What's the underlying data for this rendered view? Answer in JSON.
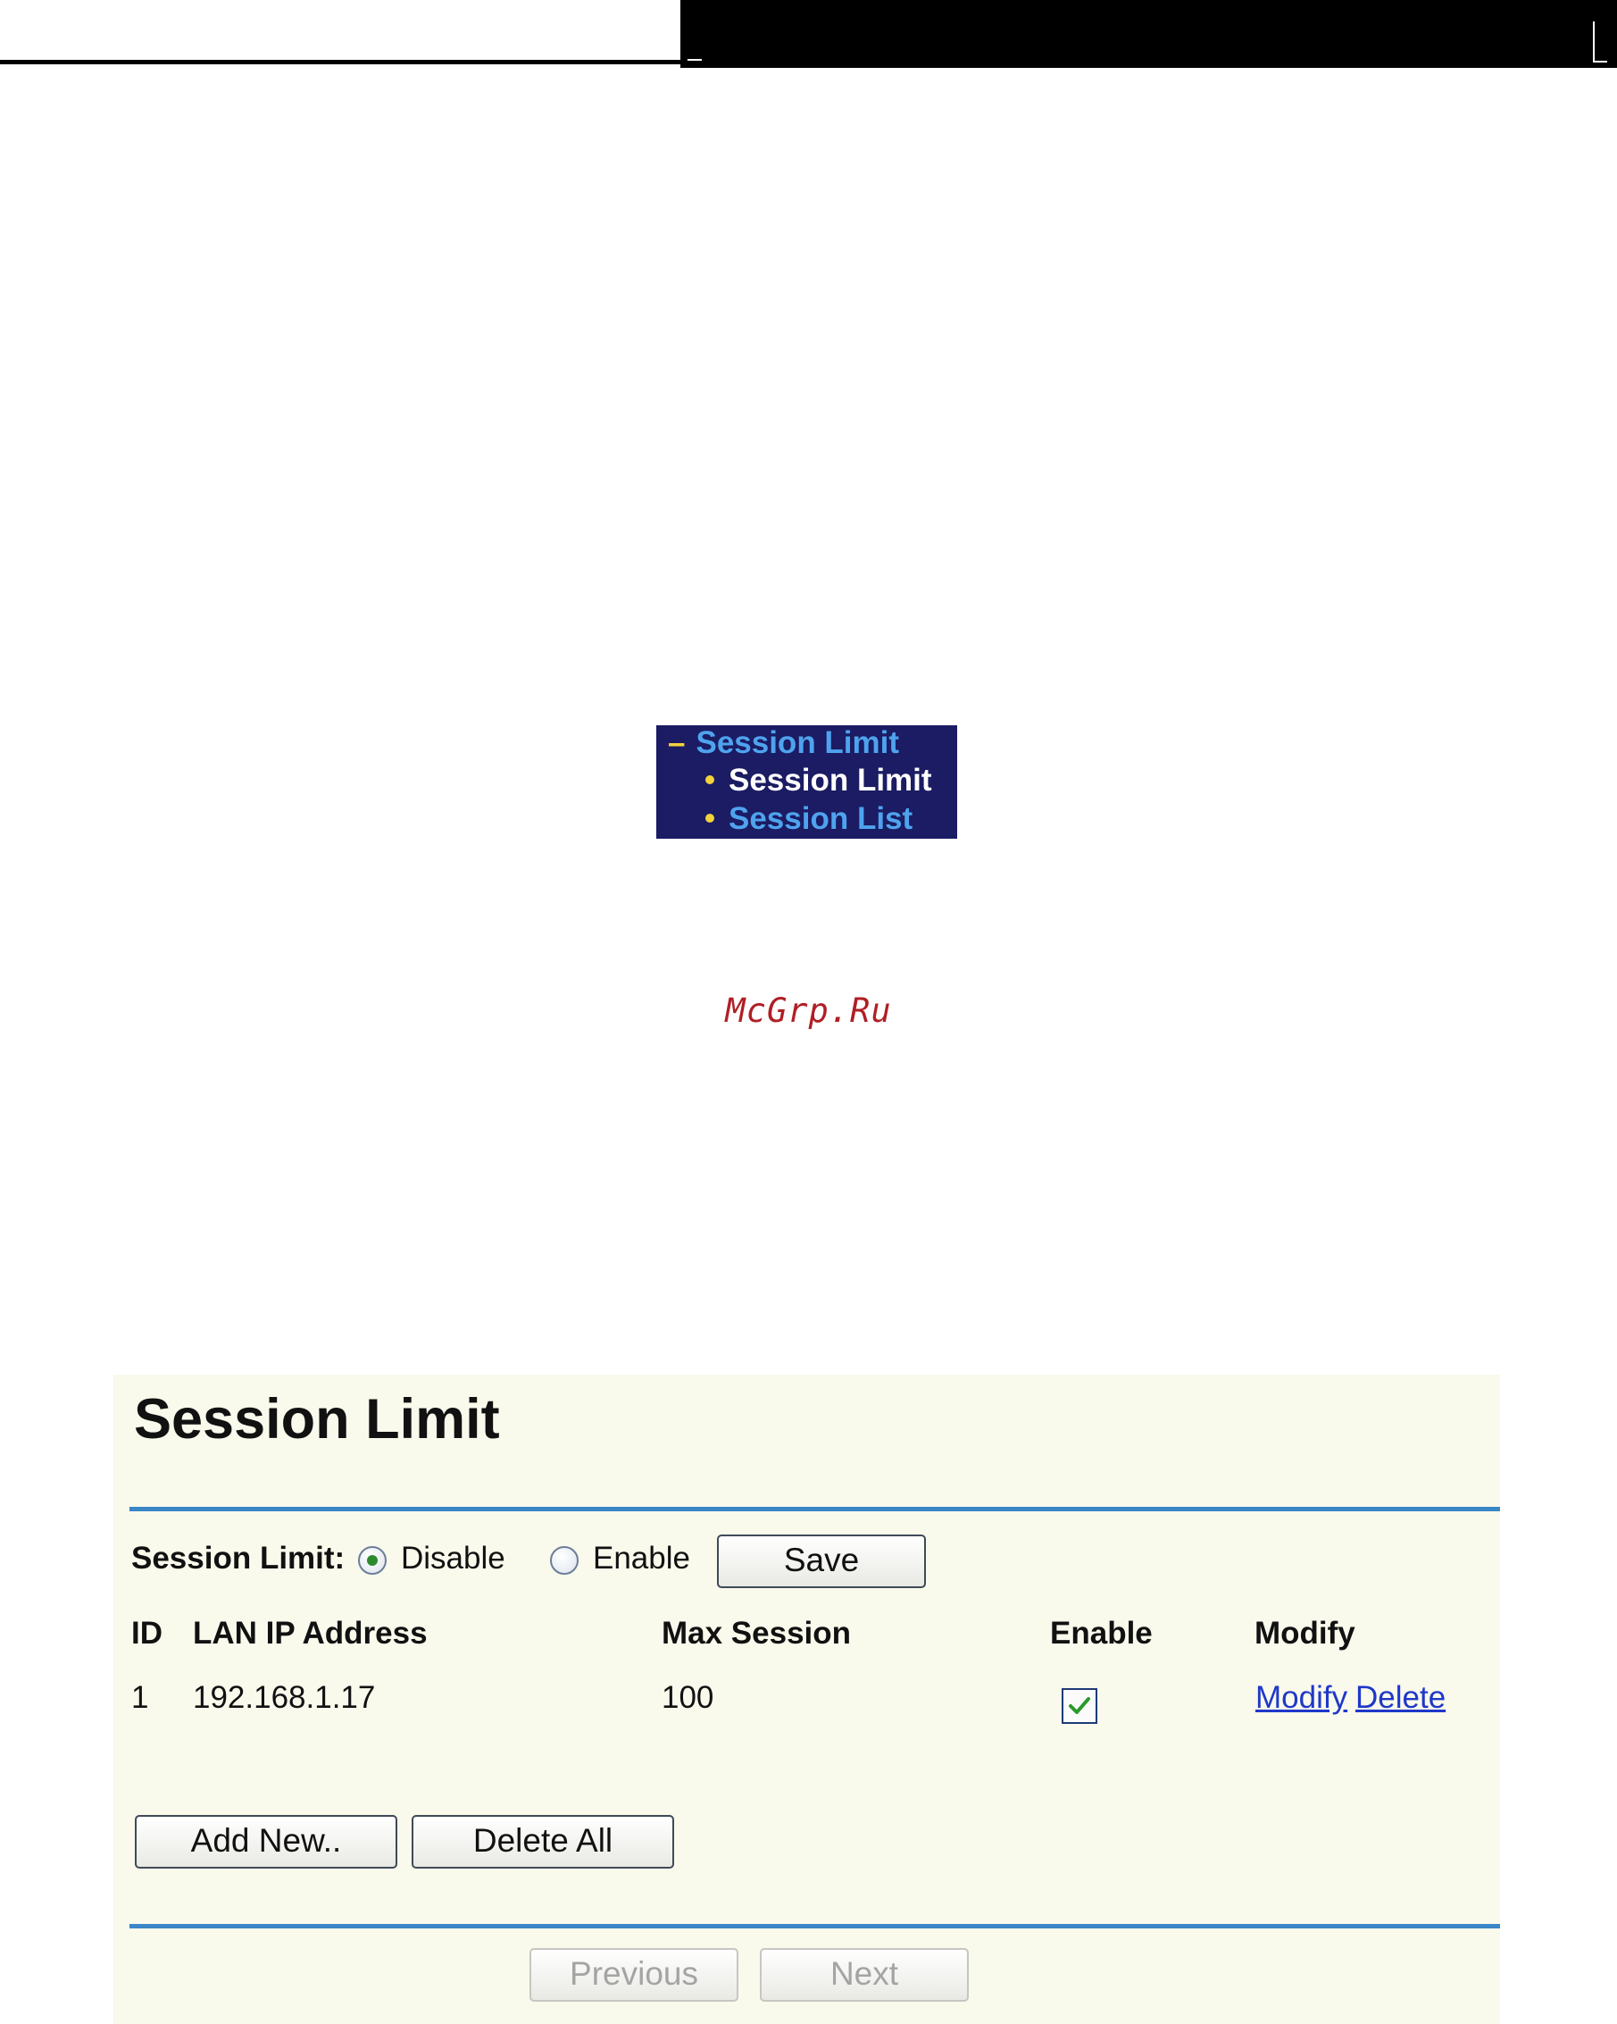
{
  "menu": {
    "section": "Session Limit",
    "items": [
      {
        "label": "Session Limit"
      },
      {
        "label": "Session List"
      }
    ]
  },
  "watermark": "McGrp.Ru",
  "panel": {
    "title": "Session Limit",
    "session_limit_label": "Session Limit:",
    "options": {
      "disable": "Disable",
      "enable": "Enable",
      "selected": "Disable"
    },
    "save_label": "Save",
    "table": {
      "headers": [
        "ID",
        "LAN IP Address",
        "Max Session",
        "Enable",
        "Modify"
      ],
      "rows": [
        {
          "id": "1",
          "ip": "192.168.1.17",
          "max_session": "100",
          "enabled": true,
          "modify": "Modify",
          "delete": "Delete"
        }
      ]
    },
    "add_new_label": "Add New..",
    "delete_all_label": "Delete All",
    "previous_label": "Previous",
    "next_label": "Next"
  },
  "colors": {
    "menu_bg": "#1b1c63",
    "menu_active": "#4fa3ee",
    "rule": "#3a86c6",
    "panel_bg": "#f9f9ec",
    "link": "#1f38c9",
    "watermark": "#b01f24"
  }
}
